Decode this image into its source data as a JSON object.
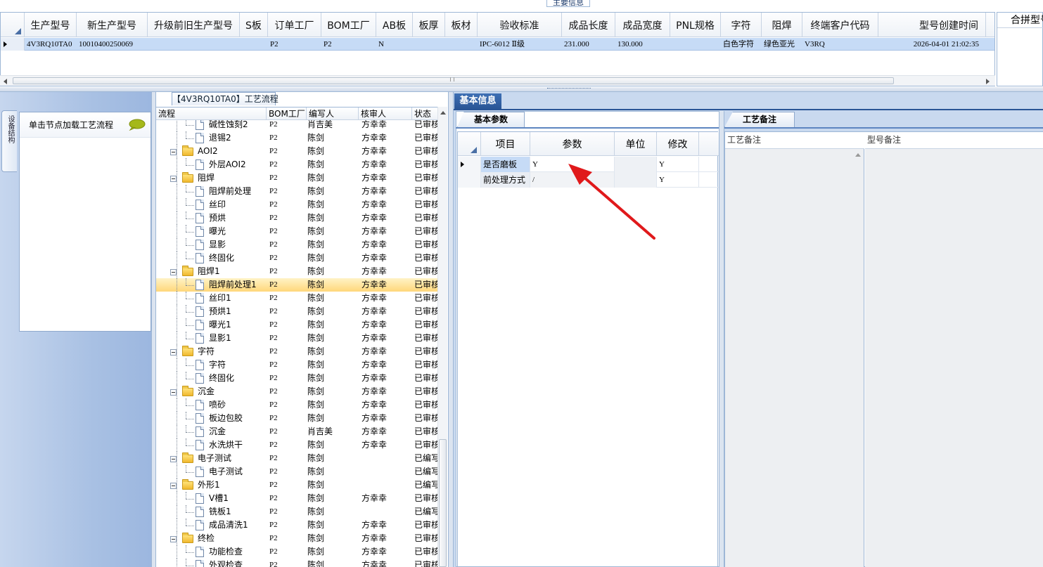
{
  "top": {
    "section_tab": "主要信息",
    "columns": [
      {
        "label": "生产型号"
      },
      {
        "label": "新生产型号"
      },
      {
        "label": "升级前旧生产型号"
      },
      {
        "label": "S板"
      },
      {
        "label": "订单工厂"
      },
      {
        "label": "BOM工厂"
      },
      {
        "label": "AB板"
      },
      {
        "label": "板厚"
      },
      {
        "label": "板材"
      },
      {
        "label": "验收标准"
      },
      {
        "label": "成品长度"
      },
      {
        "label": "成品宽度"
      },
      {
        "label": "PNL规格"
      },
      {
        "label": "字符"
      },
      {
        "label": "阻焊"
      },
      {
        "label": "终端客户代码"
      },
      {
        "label": "型号创建时间"
      }
    ],
    "row": [
      "4V3RQ10TA0",
      "10010400250069",
      "",
      "",
      "P2",
      "P2",
      "N",
      "",
      "",
      "IPC-6012 Ⅱ级",
      "231.000",
      "130.000",
      "",
      "白色字符",
      "绿色亚光",
      "V3RQ",
      "2026-04-01 21:02:35"
    ],
    "merge_header": "合拼型号"
  },
  "left": {
    "vertical_tab": "设备结构",
    "load_hint": "单击节点加载工艺流程"
  },
  "tree": {
    "title": "【4V3RQ10TA0】工艺流程",
    "headers": {
      "flow": "流程",
      "factory": "BOM工厂",
      "writer": "编写人",
      "reviewer": "核审人",
      "status": "状态"
    },
    "rows": [
      {
        "name": "碱性蚀刻2",
        "level": 2,
        "factory": "P2",
        "writer": "肖吉美",
        "reviewer": "方幸幸",
        "status": "已审核"
      },
      {
        "name": "退锡2",
        "level": 2,
        "factory": "P2",
        "writer": "陈剑",
        "reviewer": "方幸幸",
        "status": "已审核"
      },
      {
        "name": "AOI2",
        "level": 1,
        "factory": "P2",
        "writer": "陈剑",
        "reviewer": "方幸幸",
        "status": "已审核"
      },
      {
        "name": "外层AOI2",
        "level": 2,
        "factory": "P2",
        "writer": "陈剑",
        "reviewer": "方幸幸",
        "status": "已审核"
      },
      {
        "name": "阻焊",
        "level": 1,
        "factory": "P2",
        "writer": "陈剑",
        "reviewer": "方幸幸",
        "status": "已审核"
      },
      {
        "name": "阻焊前处理",
        "level": 2,
        "factory": "P2",
        "writer": "陈剑",
        "reviewer": "方幸幸",
        "status": "已审核"
      },
      {
        "name": "丝印",
        "level": 2,
        "factory": "P2",
        "writer": "陈剑",
        "reviewer": "方幸幸",
        "status": "已审核"
      },
      {
        "name": "预烘",
        "level": 2,
        "factory": "P2",
        "writer": "陈剑",
        "reviewer": "方幸幸",
        "status": "已审核"
      },
      {
        "name": "曝光",
        "level": 2,
        "factory": "P2",
        "writer": "陈剑",
        "reviewer": "方幸幸",
        "status": "已审核"
      },
      {
        "name": "显影",
        "level": 2,
        "factory": "P2",
        "writer": "陈剑",
        "reviewer": "方幸幸",
        "status": "已审核"
      },
      {
        "name": "终固化",
        "level": 2,
        "factory": "P2",
        "writer": "陈剑",
        "reviewer": "方幸幸",
        "status": "已审核"
      },
      {
        "name": "阻焊1",
        "level": 1,
        "factory": "P2",
        "writer": "陈剑",
        "reviewer": "方幸幸",
        "status": "已审核"
      },
      {
        "name": "阻焊前处理1",
        "level": 2,
        "factory": "P2",
        "writer": "陈剑",
        "reviewer": "方幸幸",
        "status": "已审核",
        "selected": true
      },
      {
        "name": "丝印1",
        "level": 2,
        "factory": "P2",
        "writer": "陈剑",
        "reviewer": "方幸幸",
        "status": "已审核"
      },
      {
        "name": "预烘1",
        "level": 2,
        "factory": "P2",
        "writer": "陈剑",
        "reviewer": "方幸幸",
        "status": "已审核"
      },
      {
        "name": "曝光1",
        "level": 2,
        "factory": "P2",
        "writer": "陈剑",
        "reviewer": "方幸幸",
        "status": "已审核"
      },
      {
        "name": "显影1",
        "level": 2,
        "factory": "P2",
        "writer": "陈剑",
        "reviewer": "方幸幸",
        "status": "已审核"
      },
      {
        "name": "字符",
        "level": 1,
        "factory": "P2",
        "writer": "陈剑",
        "reviewer": "方幸幸",
        "status": "已审核"
      },
      {
        "name": "字符",
        "level": 2,
        "factory": "P2",
        "writer": "陈剑",
        "reviewer": "方幸幸",
        "status": "已审核"
      },
      {
        "name": "终固化",
        "level": 2,
        "factory": "P2",
        "writer": "陈剑",
        "reviewer": "方幸幸",
        "status": "已审核"
      },
      {
        "name": "沉金",
        "level": 1,
        "factory": "P2",
        "writer": "陈剑",
        "reviewer": "方幸幸",
        "status": "已审核"
      },
      {
        "name": "喷砂",
        "level": 2,
        "factory": "P2",
        "writer": "陈剑",
        "reviewer": "方幸幸",
        "status": "已审核"
      },
      {
        "name": "板边包胶",
        "level": 2,
        "factory": "P2",
        "writer": "陈剑",
        "reviewer": "方幸幸",
        "status": "已审核"
      },
      {
        "name": "沉金",
        "level": 2,
        "factory": "P2",
        "writer": "肖吉美",
        "reviewer": "方幸幸",
        "status": "已审核"
      },
      {
        "name": "水洗烘干",
        "level": 2,
        "factory": "P2",
        "writer": "陈剑",
        "reviewer": "方幸幸",
        "status": "已审核"
      },
      {
        "name": "电子测试",
        "level": 1,
        "factory": "P2",
        "writer": "陈剑",
        "reviewer": "",
        "status": "已编写"
      },
      {
        "name": "电子测试",
        "level": 2,
        "factory": "P2",
        "writer": "陈剑",
        "reviewer": "",
        "status": "已编写"
      },
      {
        "name": "外形1",
        "level": 1,
        "factory": "P2",
        "writer": "陈剑",
        "reviewer": "",
        "status": "已编写"
      },
      {
        "name": "V槽1",
        "level": 2,
        "factory": "P2",
        "writer": "陈剑",
        "reviewer": "方幸幸",
        "status": "已审核"
      },
      {
        "name": "铣板1",
        "level": 2,
        "factory": "P2",
        "writer": "陈剑",
        "reviewer": "",
        "status": "已编写"
      },
      {
        "name": "成品清洗1",
        "level": 2,
        "factory": "P2",
        "writer": "陈剑",
        "reviewer": "方幸幸",
        "status": "已审核"
      },
      {
        "name": "终检",
        "level": 1,
        "factory": "P2",
        "writer": "陈剑",
        "reviewer": "方幸幸",
        "status": "已审核"
      },
      {
        "name": "功能检查",
        "level": 2,
        "factory": "P2",
        "writer": "陈剑",
        "reviewer": "方幸幸",
        "status": "已审核"
      },
      {
        "name": "外观检查",
        "level": 2,
        "factory": "P2",
        "writer": "陈剑",
        "reviewer": "方幸幸",
        "status": "已审核"
      }
    ]
  },
  "right": {
    "main_tab": "基本信息",
    "param_tab": "基本参数",
    "param_headers": {
      "item": "项目",
      "param": "参数",
      "unit": "单位",
      "modify": "修改"
    },
    "params": [
      {
        "item": "是否磨板",
        "param": "Y",
        "unit": "",
        "modify": "Y"
      },
      {
        "item": "前处理方式",
        "param": "/",
        "unit": "",
        "modify": "Y"
      }
    ],
    "remark_tab": "工艺备注",
    "process_note_label": "工艺备注",
    "model_note_label": "型号备注"
  },
  "colors": {
    "selected_row": "#c6dbf6",
    "tab_active": "#2a5596",
    "annotation_arrow": "#e0191b"
  }
}
